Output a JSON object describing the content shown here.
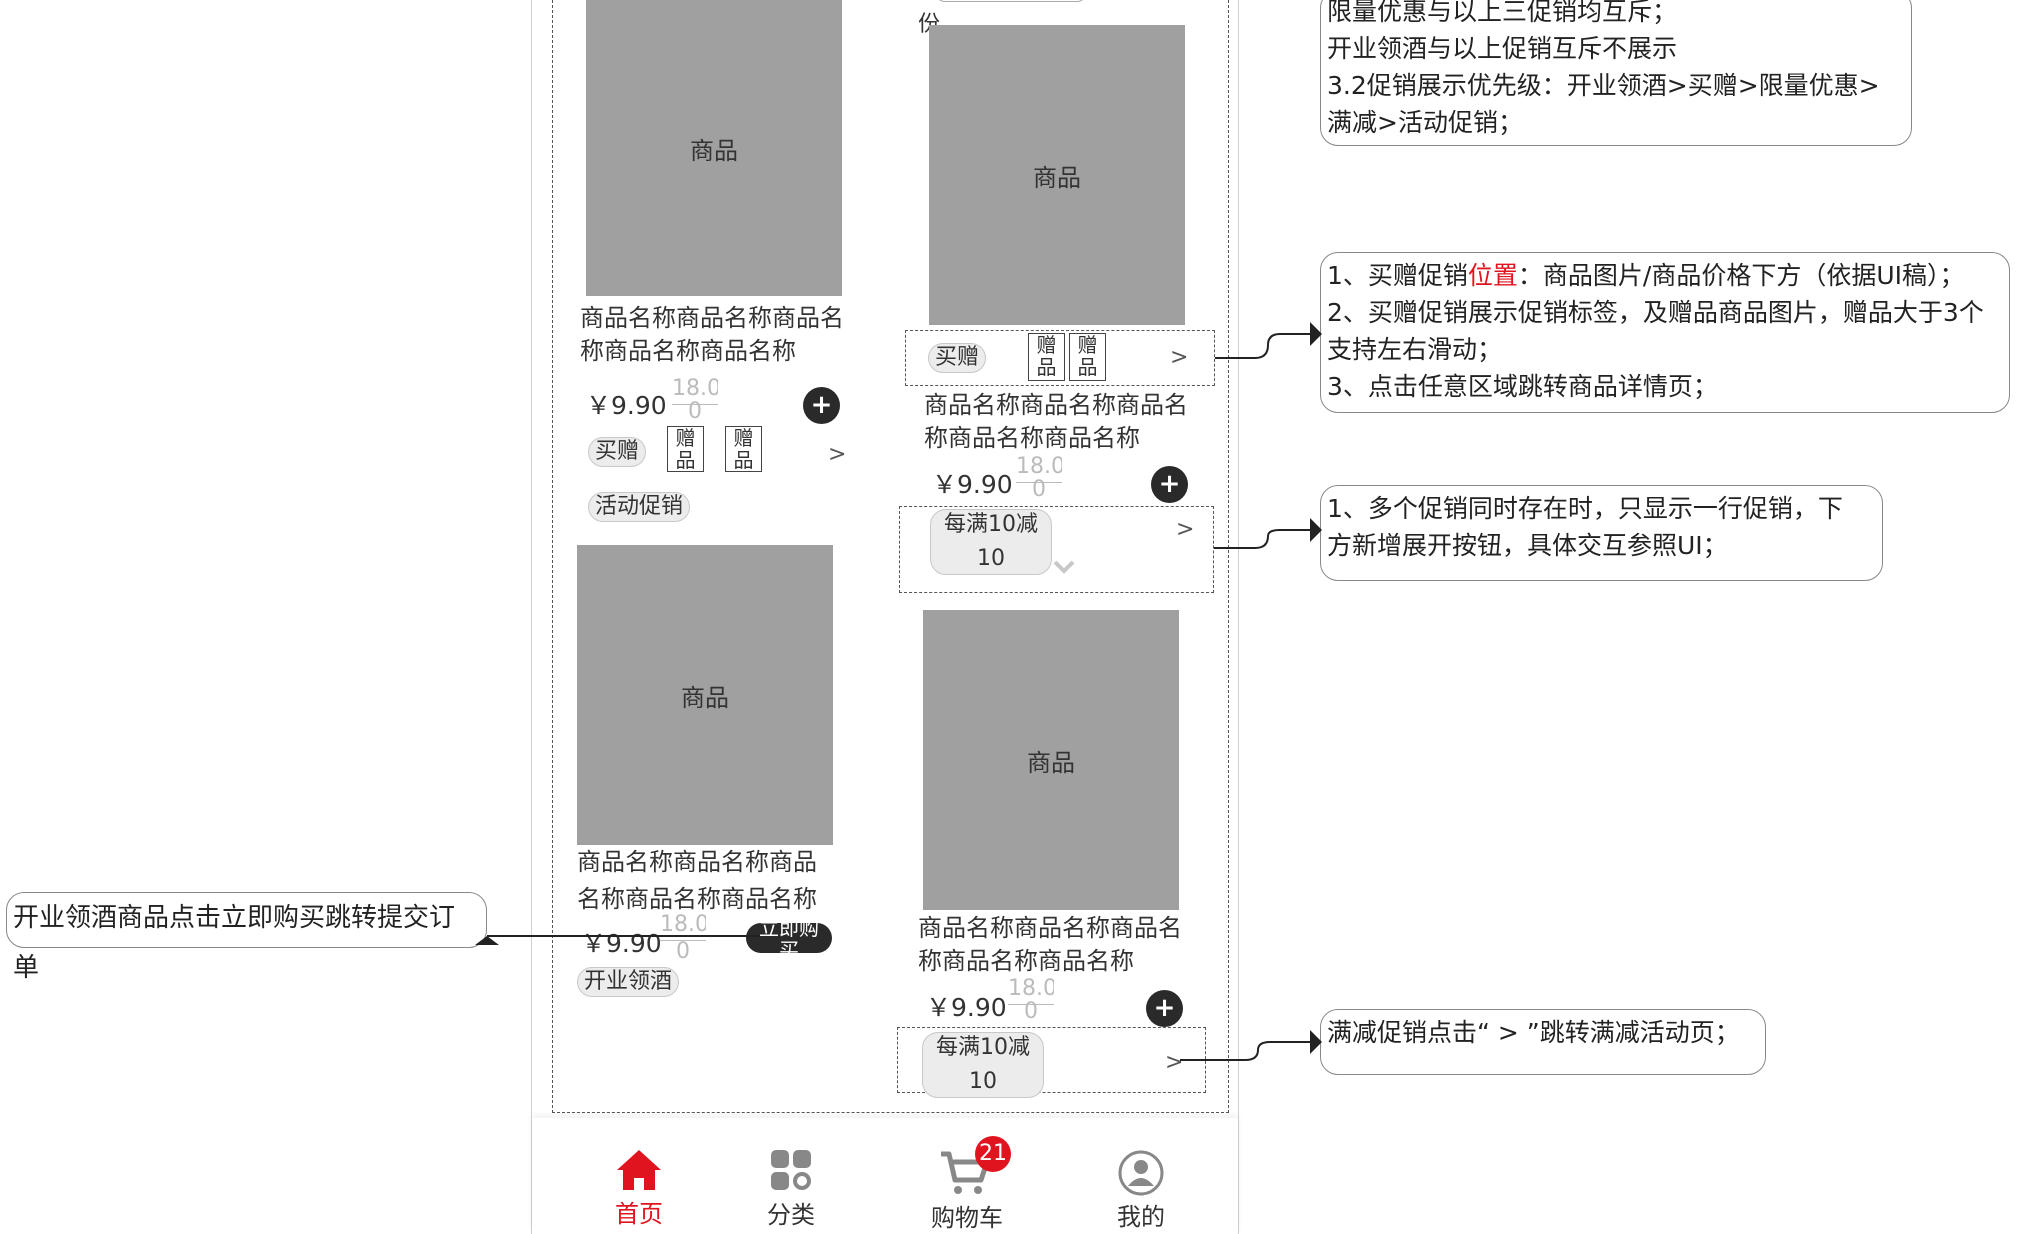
{
  "products": [
    {
      "img_label": "商品",
      "name_line1": "商品名称商品名称商品名",
      "name_line2": "称商品名称商品名称",
      "price": "￥9.90",
      "old_price": "18.0",
      "old_price_tail": "0"
    },
    {
      "img_label": "商品",
      "name_line1": "商品名称商品名称商品名",
      "name_line2": "称商品名称商品名称",
      "price": "￥9.90",
      "old_price": "18.0",
      "old_price_tail": "0"
    },
    {
      "img_label": "商品",
      "name_line1": "商品名称商品名称商品",
      "name_line2": "名称商品名称商品名称",
      "price": "￥9.90",
      "old_price": "18.0",
      "old_price_tail": "0"
    },
    {
      "img_label": "商品",
      "name_line1": "商品名称商品名称商品名",
      "name_line2": "称商品名称商品名称",
      "price": "￥9.90",
      "old_price": "18.0",
      "old_price_tail": "0"
    }
  ],
  "top_fragment": "份",
  "tags": {
    "buy_gift": "买赠",
    "gift_char1": "赠",
    "gift_char2": "品",
    "activity": "活动促销",
    "opening_wine": "开业领酒",
    "full_reduce_1": "每满10减",
    "full_reduce_2": "10",
    "chevron": ">",
    "buy_now_1": "立即购",
    "buy_now_2": "买"
  },
  "notes": {
    "top": [
      "限量优惠与以上三促销均互斥；",
      "开业领酒与以上促销互斥不展示",
      "3.2促销展示优先级：开业领酒>买赠>限量优惠>",
      "满减>活动促销；"
    ],
    "gift_pre": "1、买赠促销",
    "gift_red": "位置",
    "gift_post": "：商品图片/商品价格下方（依据UI稿）；",
    "gift_line2": "2、买赠促销展示促销标签，及赠品商品图片，赠品大于3个",
    "gift_line3": "支持左右滑动；",
    "gift_line4": "3、点击任意区域跳转商品详情页；",
    "multi_line1": "1、多个促销同时存在时，只显示一行促销，下",
    "multi_line2": "方新增展开按钮，具体交互参照UI；",
    "reduce": "满减促销点击“ > ”跳转满减活动页；",
    "opening": "开业领酒商品点击立即购买跳转提交订单"
  },
  "nav": {
    "home": "首页",
    "category": "分类",
    "cart": "购物车",
    "cart_count": "21",
    "mine": "我的"
  },
  "colors": {
    "accent": "#e0141e",
    "image_placeholder": "#a0a0a0",
    "dark_button": "#2a2a2a"
  }
}
